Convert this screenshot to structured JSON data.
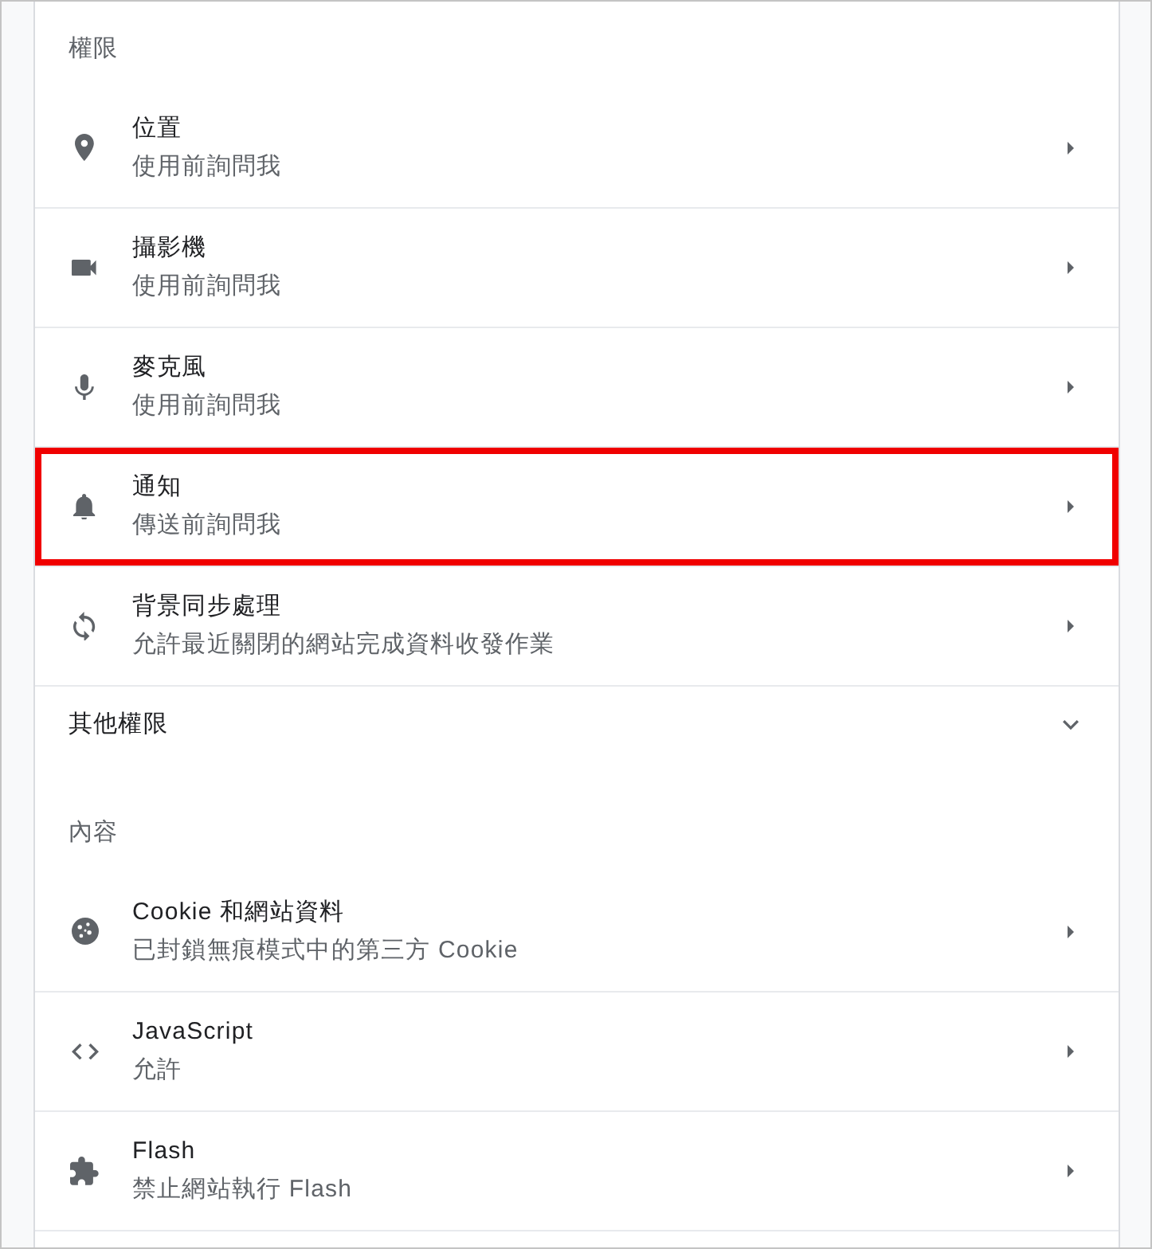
{
  "sections": [
    {
      "heading": "權限",
      "rows": [
        {
          "title": "位置",
          "description": "使用前詢問我",
          "highlighted": false
        },
        {
          "title": "攝影機",
          "description": "使用前詢問我",
          "highlighted": false
        },
        {
          "title": "麥克風",
          "description": "使用前詢問我",
          "highlighted": false
        },
        {
          "title": "通知",
          "description": "傳送前詢問我",
          "highlighted": true
        },
        {
          "title": "背景同步處理",
          "description": "允許最近關閉的網站完成資料收發作業",
          "highlighted": false
        }
      ],
      "more": {
        "label": "其他權限",
        "expanded": false
      }
    },
    {
      "heading": "內容",
      "rows": [
        {
          "title": "Cookie 和網站資料",
          "description": "已封鎖無痕模式中的第三方 Cookie",
          "highlighted": false
        },
        {
          "title": "JavaScript",
          "description": "允許",
          "highlighted": false
        },
        {
          "title": "Flash",
          "description": "禁止網站執行 Flash",
          "highlighted": false
        }
      ]
    }
  ]
}
